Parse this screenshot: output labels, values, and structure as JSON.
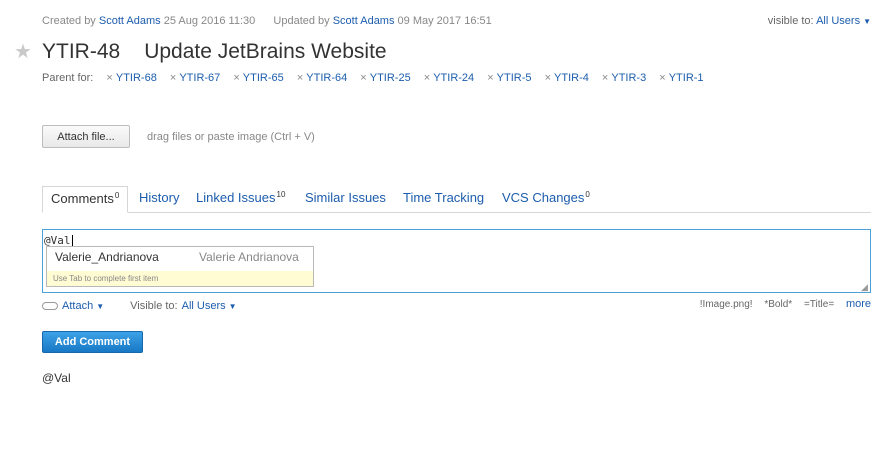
{
  "meta": {
    "created_label": "Created by",
    "created_by": "Scott Adams",
    "created_date": "25 Aug 2016 11:30",
    "updated_label": "Updated by",
    "updated_by": "Scott Adams",
    "updated_date": "09 May 2017 16:51",
    "visible_label": "visible to:",
    "visible_value": "All Users"
  },
  "issue": {
    "id": "YTIR-48",
    "summary": "Update JetBrains Website",
    "star_icon": "star-icon"
  },
  "parent": {
    "label": "Parent for:",
    "remove_glyph": "×",
    "links": [
      "YTIR-68",
      "YTIR-67",
      "YTIR-65",
      "YTIR-64",
      "YTIR-25",
      "YTIR-24",
      "YTIR-5",
      "YTIR-4",
      "YTIR-3",
      "YTIR-1"
    ]
  },
  "attach": {
    "button_label": "Attach file...",
    "hint": "drag files or paste image (Ctrl + V)"
  },
  "tabs": [
    {
      "label": "Comments",
      "count": "0"
    },
    {
      "label": "History",
      "count": ""
    },
    {
      "label": "Linked Issues",
      "count": "10"
    },
    {
      "label": "Similar Issues",
      "count": ""
    },
    {
      "label": "Time Tracking",
      "count": ""
    },
    {
      "label": "VCS Changes",
      "count": "0"
    }
  ],
  "comment": {
    "text": "@Val",
    "suggestion_login": "Valerie_Andrianova",
    "suggestion_name": "Valerie Andrianova",
    "suggestion_hint": "Use Tab to complete first item",
    "attach_label": "Attach",
    "visible_label": "Visible to:",
    "visible_value": "All Users",
    "markup": [
      "!Image.png!",
      "*Bold*",
      "=Title="
    ],
    "more_label": "more",
    "add_button": "Add Comment",
    "preview": "@Val"
  },
  "colors": {
    "link": "#1c5dad",
    "focus_border": "#4ba2d6",
    "primary_button": "#2a8cd8",
    "hint_bg": "#fffbd3"
  }
}
